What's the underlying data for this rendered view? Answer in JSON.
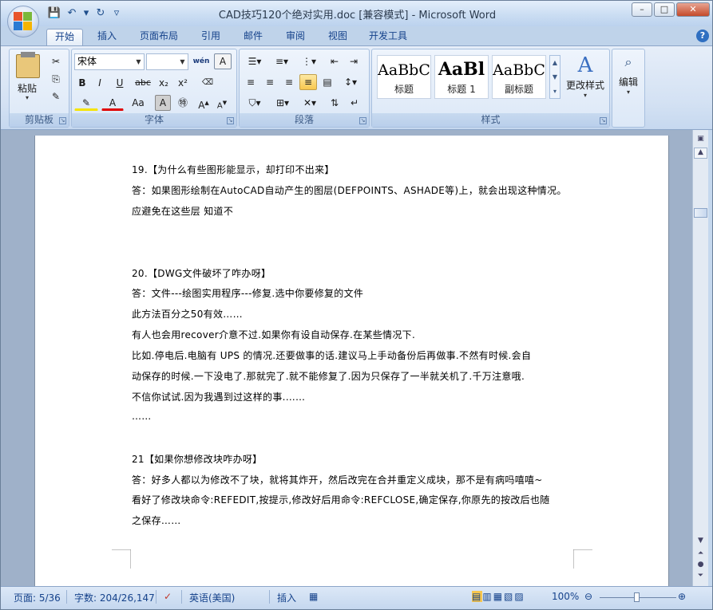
{
  "window": {
    "title": "CAD技巧120个绝对实用.doc [兼容模式] - Microsoft Word",
    "minimize": "–",
    "maximize": "□",
    "close": "✕"
  },
  "quick_access": {
    "save_icon": "save-icon",
    "undo_icon": "undo-icon",
    "redo_icon": "redo-icon",
    "customize_icon": "customize-icon"
  },
  "tabs": [
    "开始",
    "插入",
    "页面布局",
    "引用",
    "邮件",
    "审阅",
    "视图",
    "开发工具"
  ],
  "help": "?",
  "ribbon": {
    "clipboard": {
      "label": "剪贴板",
      "paste": "粘贴"
    },
    "font": {
      "label": "字体",
      "name": "宋体",
      "size": "",
      "buttons": [
        "B",
        "I",
        "U",
        "abc",
        "x₂",
        "x²",
        "Aa",
        "A"
      ]
    },
    "paragraph": {
      "label": "段落"
    },
    "styles": {
      "label": "样式",
      "items": [
        {
          "preview": "AaBbC",
          "name": "标题"
        },
        {
          "preview": "AaBl",
          "name": "标题 1"
        },
        {
          "preview": "AaBbC",
          "name": "副标题"
        }
      ],
      "change": "更改样式"
    },
    "editing": {
      "label": "编辑"
    }
  },
  "document": {
    "lines": [
      "19.【为什么有些图形能显示，却打印不出来】",
      "答：如果图形绘制在AutoCAD自动产生的图层(DEFPOINTS、ASHADE等)上，就会出现这种情况。",
      "应避免在这些层 知道不",
      "",
      "",
      "20.【DWG文件破坏了咋办呀】",
      "答：文件---绘图实用程序---修复.选中你要修复的文件",
      "此方法百分之50有效……",
      "有人也会用recover介意不过.如果你有设自动保存.在某些情况下.",
      "比如.停电后.电脑有 UPS 的情况.还要做事的话.建议马上手动备份后再做事.不然有时候.会自",
      "动保存的时候.一下没电了.那就完了.就不能修复了.因为只保存了一半就关机了.千万注意哦.",
      "不信你试试.因为我遇到过这样的事.……",
      "……",
      "",
      "21【如果你想修改块咋办呀】",
      "答：好多人都以为修改不了块，就将其炸开，然后改完在合并重定义成块，那不是有病吗嘻嘻~",
      "看好了修改块命令:REFEDIT,按提示,修改好后用命令:REFCLOSE,确定保存,你原先的按改后也随",
      "之保存……"
    ]
  },
  "status": {
    "page": "页面: 5/36",
    "words": "字数: 204/26,147",
    "language": "英语(美国)",
    "mode": "插入",
    "zoom": "100%"
  }
}
